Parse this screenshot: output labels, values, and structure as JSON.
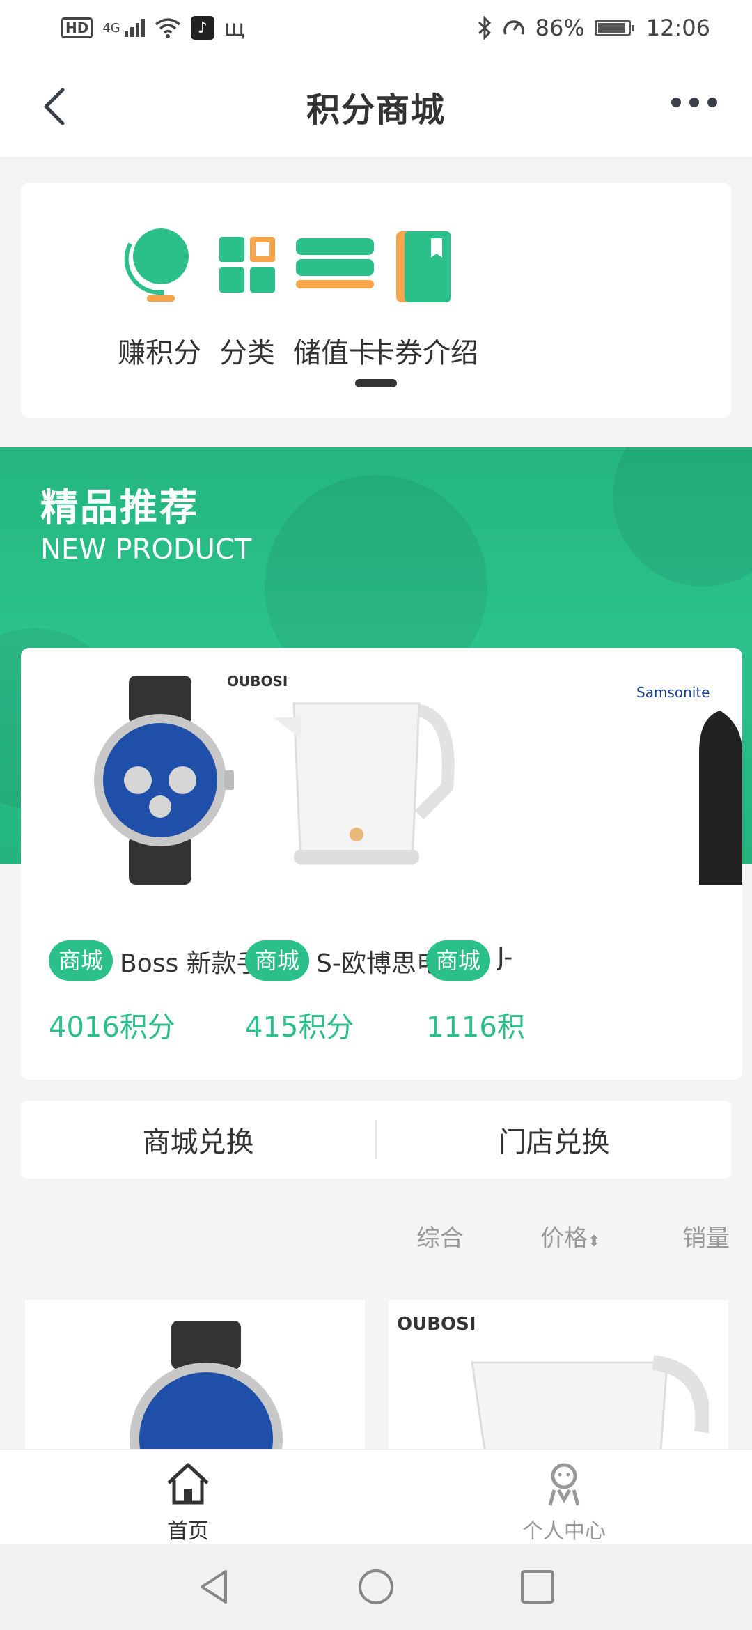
{
  "status_bar": {
    "network": "4G",
    "battery": "86%",
    "time": "12:06",
    "hd": "HD",
    "app_glyph": "♪",
    "extra": "щ"
  },
  "header": {
    "title": "积分商城"
  },
  "categories": [
    {
      "label": "赚积分",
      "icon": "globe-icon"
    },
    {
      "label": "分类",
      "icon": "grid-icon"
    },
    {
      "label": "储值卡",
      "icon": "card-stack-icon"
    },
    {
      "label": "卡券介绍",
      "icon": "book-icon"
    }
  ],
  "banner": {
    "title": "精品推荐",
    "subtitle": "NEW PRODUCT"
  },
  "featured_products": [
    {
      "tag": "商城",
      "name": "Boss 新款手...",
      "points": "4016积分",
      "brand": ""
    },
    {
      "tag": "商城",
      "name": "S-欧博思电热...",
      "points": "415积分",
      "brand": "OUBOSI"
    },
    {
      "tag": "商城",
      "name": "J-",
      "points": "1116积",
      "brand": "Samsonite"
    }
  ],
  "exchange_tabs": {
    "mall": "商城兑换",
    "store": "门店兑换"
  },
  "sort": {
    "overall": "综合",
    "price": "价格",
    "price_arrow": "⬍",
    "sales": "销量"
  },
  "grid_products": [
    {
      "brand": ""
    },
    {
      "brand": "OUBOSI"
    }
  ],
  "bottom_nav": {
    "home": "首页",
    "profile": "个人中心"
  },
  "colors": {
    "accent": "#2bbf8a",
    "orange": "#f7a44a"
  }
}
